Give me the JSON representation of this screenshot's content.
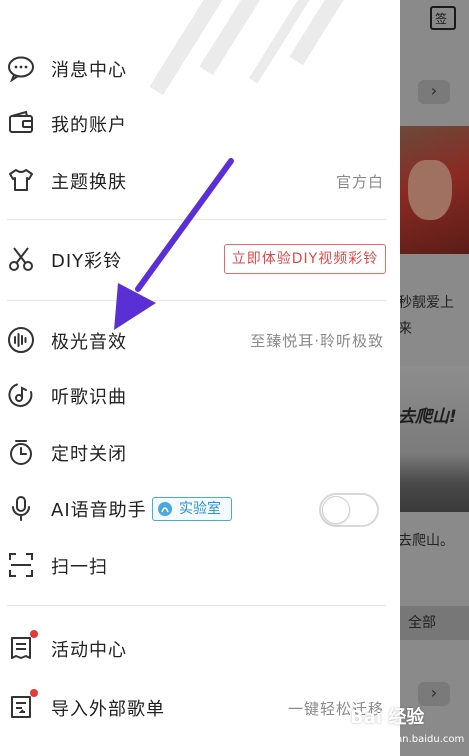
{
  "background_app": {
    "calendar_label": "签",
    "chevron": "›",
    "item1_text": "秒靓爱上",
    "item1_text2": "来",
    "photo2_caption": "去爬山!",
    "item2_text": "去爬山。",
    "all_button": "全部"
  },
  "menu": {
    "items": [
      {
        "label": "消息中心",
        "sub": ""
      },
      {
        "label": "我的账户",
        "sub": ""
      },
      {
        "label": "主题换肤",
        "sub": "官方白"
      },
      {
        "label": "DIY彩铃",
        "sub": ""
      },
      {
        "label": "极光音效",
        "sub": "至臻悦耳·聆听极致"
      },
      {
        "label": "听歌识曲",
        "sub": ""
      },
      {
        "label": "定时关闭",
        "sub": ""
      },
      {
        "label": "AI语音助手",
        "sub": ""
      },
      {
        "label": "扫一扫",
        "sub": ""
      },
      {
        "label": "活动中心",
        "sub": ""
      },
      {
        "label": "导入外部歌单",
        "sub": "一键轻松迁移"
      }
    ],
    "promo_button": "立即体验DIY视频彩铃",
    "lab_badge": "实验室",
    "ai_toggle_on": false
  },
  "watermark": {
    "brand": "Bai 经验",
    "url": "jingyan.baidu.com"
  },
  "colors": {
    "arrow": "#5b2fd6",
    "notification_dot": "#e53935",
    "promo": "#e24848",
    "lab": "#2e92cf"
  }
}
